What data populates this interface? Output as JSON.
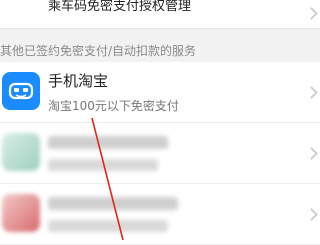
{
  "top_item": {
    "label": "乘车码免密支付授权管理"
  },
  "section_header": "其他已签约免密支付/自动扣款的服务",
  "services": [
    {
      "name": "手机淘宝",
      "subtitle": "淘宝100元以下免密支付",
      "icon": "taobao-icon"
    },
    {
      "name": "",
      "subtitle": "",
      "icon": "blurred-app-icon"
    },
    {
      "name": "",
      "subtitle": "",
      "icon": "blurred-app-icon"
    }
  ],
  "colors": {
    "taobao_blue": "#1a8cff",
    "annotation_red": "#e0261c"
  }
}
